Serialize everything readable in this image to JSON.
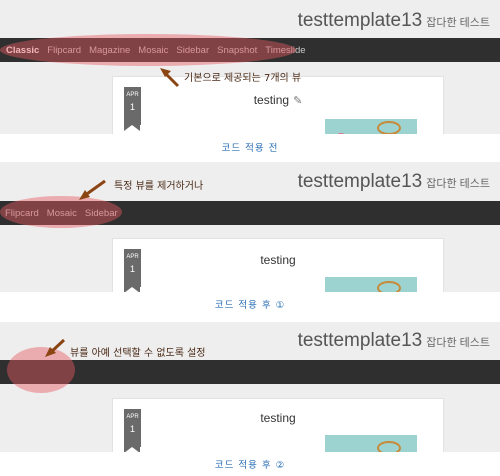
{
  "blog": {
    "title": "testtemplate13",
    "subtitle": "잡다한 테스트"
  },
  "panel1": {
    "nav": [
      "Classic",
      "Flipcard",
      "Magazine",
      "Mosaic",
      "Sidebar",
      "Snapshot",
      "Timeslide"
    ],
    "annotation": "기본으로 제공되는 7개의 뷰",
    "caption": "코드 적용 전"
  },
  "panel2": {
    "nav": [
      "Flipcard",
      "Mosaic",
      "Sidebar"
    ],
    "annotation": "특정 뷰를 제거하거나",
    "caption": "코드 적용 후 ①"
  },
  "panel3": {
    "annotation": "뷰를 아예 선택할 수 없도록 설정",
    "caption": "코드 적용 후 ②"
  },
  "post": {
    "month": "APR",
    "day": "1",
    "title": "testing"
  },
  "colors": {
    "navbar": "#2f2f2f",
    "highlight": "#e65a64",
    "caption": "#2a6fb5",
    "arrow": "#8b4513"
  }
}
